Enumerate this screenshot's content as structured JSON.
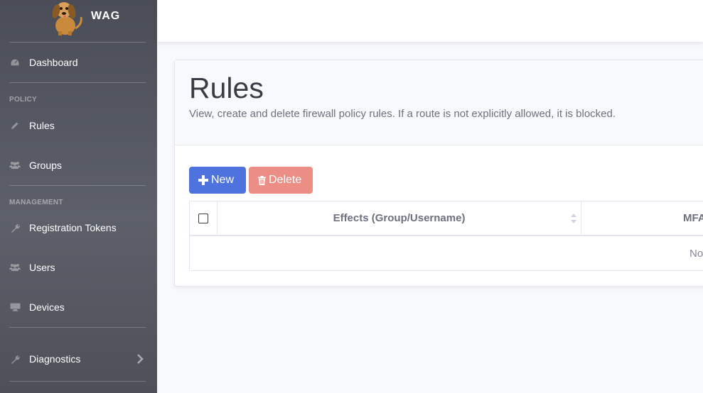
{
  "brand": {
    "name": "WAG",
    "logo_icon": "dog-logo-icon"
  },
  "sidebar": {
    "dashboard": {
      "label": "Dashboard",
      "icon": "dashboard-icon"
    },
    "policy_heading": "POLICY",
    "rules": {
      "label": "Rules",
      "icon": "pencil-icon"
    },
    "groups": {
      "label": "Groups",
      "icon": "users-icon"
    },
    "management_heading": "MANAGEMENT",
    "registration_tokens": {
      "label": "Registration Tokens",
      "icon": "wrench-icon"
    },
    "users": {
      "label": "Users",
      "icon": "users-icon"
    },
    "devices": {
      "label": "Devices",
      "icon": "desktop-icon"
    },
    "diagnostics": {
      "label": "Diagnostics",
      "icon": "wrench-icon",
      "chevron": "chevron-right-icon"
    }
  },
  "page": {
    "title": "Rules",
    "subtitle": "View, create and delete firewall policy rules. If a route is not explicitly allowed, it is blocked."
  },
  "toolbar": {
    "new_label": "New",
    "delete_label": "Delete"
  },
  "table": {
    "columns": [
      "Effects (Group/Username)",
      "MFA"
    ],
    "empty_text": "No"
  },
  "colors": {
    "sidebar": "#4a4d57",
    "primary": "#4e73df",
    "danger_disabled": "#ec8e86",
    "background": "#f8f9fc"
  }
}
